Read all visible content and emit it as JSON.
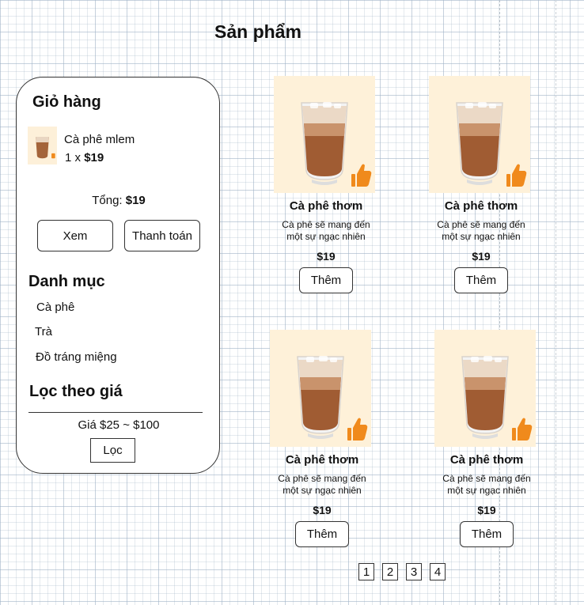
{
  "page_title": "Sản phẩm",
  "cart": {
    "title": "Giỏ hàng",
    "item_name": "Cà phê mlem",
    "item_qty": "1 x ",
    "item_price": "$19",
    "total_label": "Tổng: ",
    "total_value": "$19",
    "view_label": "Xem",
    "pay_label": "Thanh toán"
  },
  "categories": {
    "title": "Danh mục",
    "items": [
      "Cà phê",
      "Trà",
      "Đồ tráng miệng"
    ]
  },
  "price_filter": {
    "title": "Lọc theo giá",
    "range": "Giá $25 ~ $100",
    "button_label": "Lọc"
  },
  "products": [
    {
      "name": "Cà phê thơm",
      "desc_line1": "Cà phê sẽ mang đến",
      "desc_line2": "một sự ngạc nhiên",
      "price": "$19",
      "add_label": "Thêm",
      "icon": "iced-coffee-thumbs-up"
    },
    {
      "name": "Cà phê thơm",
      "desc_line1": "Cà phê sẽ mang đến",
      "desc_line2": "một sự ngạc nhiên",
      "price": "$19",
      "add_label": "Thêm",
      "icon": "iced-coffee-thumbs-up"
    },
    {
      "name": "Cà phê thơm",
      "desc_line1": "Cà phê sẽ mang đến",
      "desc_line2": "một sự ngạc nhiên",
      "price": "$19",
      "add_label": "Thêm",
      "icon": "iced-coffee-thumbs-up"
    },
    {
      "name": "Cà phê thơm",
      "desc_line1": "Cà phê sẽ mang đến",
      "desc_line2": "một sự ngạc nhiên",
      "price": "$19",
      "add_label": "Thêm",
      "icon": "iced-coffee-thumbs-up"
    }
  ],
  "pagination": [
    "1",
    "2",
    "3",
    "4"
  ],
  "colors": {
    "image_bg": "#fef1d9",
    "thumbs_up": "#f08a1c",
    "coffee": "#9b5a32"
  }
}
